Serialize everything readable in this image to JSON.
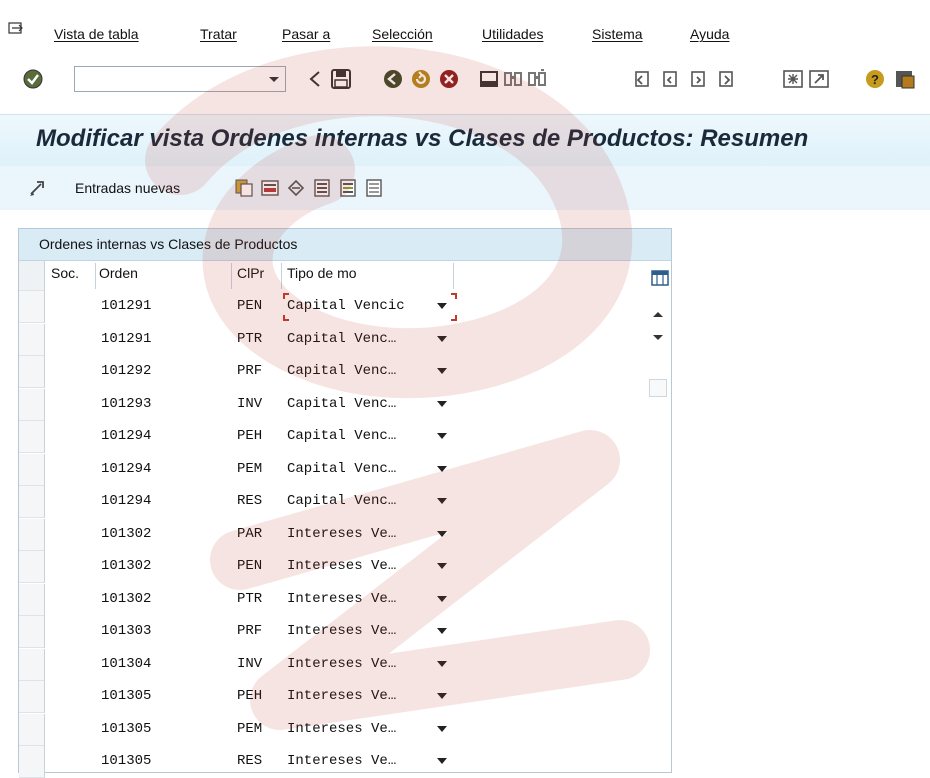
{
  "menu": {
    "items": [
      "Vista de tabla",
      "Tratar",
      "Pasar a",
      "Selección",
      "Utilidades",
      "Sistema",
      "Ayuda"
    ]
  },
  "toolbar": {
    "command_value": "",
    "icons": [
      "enter-icon",
      "back-icon",
      "save-icon",
      "nav-back-icon",
      "exit-icon",
      "cancel-icon",
      "print-icon",
      "find-icon",
      "find-next-icon",
      "first-page-icon",
      "prev-page-icon",
      "next-page-icon",
      "last-page-icon",
      "new-session-icon",
      "shortcut-icon",
      "help-icon",
      "customize-layout-icon"
    ]
  },
  "title": "Modificar vista Ordenes internas vs Clases de Productos: Resumen",
  "app_toolbar": {
    "new_entries_label": "Entradas nuevas",
    "icons": [
      "change-display-icon",
      "copy-icon",
      "delete-icon",
      "undo-icon",
      "select-all-icon",
      "select-block-icon",
      "deselect-all-icon"
    ]
  },
  "table": {
    "title": "Ordenes internas vs Clases de Productos",
    "columns": [
      "Soc.",
      "Orden",
      "ClPr",
      "Tipo de mo"
    ],
    "rows": [
      {
        "soc": "",
        "orden": "101291",
        "clpr": "PEN",
        "tipo": "Capital Vencic"
      },
      {
        "soc": "",
        "orden": "101291",
        "clpr": "PTR",
        "tipo": "Capital Venc…"
      },
      {
        "soc": "",
        "orden": "101292",
        "clpr": "PRF",
        "tipo": "Capital Venc…"
      },
      {
        "soc": "",
        "orden": "101293",
        "clpr": "INV",
        "tipo": "Capital Venc…"
      },
      {
        "soc": "",
        "orden": "101294",
        "clpr": "PEH",
        "tipo": "Capital Venc…"
      },
      {
        "soc": "",
        "orden": "101294",
        "clpr": "PEM",
        "tipo": "Capital Venc…"
      },
      {
        "soc": "",
        "orden": "101294",
        "clpr": "RES",
        "tipo": "Capital Venc…"
      },
      {
        "soc": "",
        "orden": "101302",
        "clpr": "PAR",
        "tipo": "Intereses Ve…"
      },
      {
        "soc": "",
        "orden": "101302",
        "clpr": "PEN",
        "tipo": "Intereses Ve…"
      },
      {
        "soc": "",
        "orden": "101302",
        "clpr": "PTR",
        "tipo": "Intereses Ve…"
      },
      {
        "soc": "",
        "orden": "101303",
        "clpr": "PRF",
        "tipo": "Intereses Ve…"
      },
      {
        "soc": "",
        "orden": "101304",
        "clpr": "INV",
        "tipo": "Intereses Ve…"
      },
      {
        "soc": "",
        "orden": "101305",
        "clpr": "PEH",
        "tipo": "Intereses Ve…"
      },
      {
        "soc": "",
        "orden": "101305",
        "clpr": "PEM",
        "tipo": "Intereses Ve…"
      },
      {
        "soc": "",
        "orden": "101305",
        "clpr": "RES",
        "tipo": "Intereses Ve…"
      }
    ]
  },
  "colors": {
    "title_bg": "#e3f3fb",
    "panel_header_bg": "#d9ebf5",
    "focus_marker": "#c0392b",
    "watermark": "#c0392b"
  }
}
